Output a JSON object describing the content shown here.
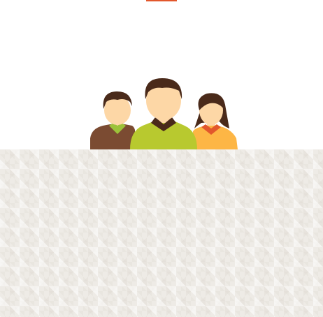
{
  "illustration": {
    "icon": "people-group-icon",
    "figures": [
      "person-left-icon",
      "person-center-icon",
      "person-right-icon"
    ]
  },
  "colors": {
    "accent": "#e2572c",
    "skin": "#fdd7a6",
    "hair": "#4a2a1a",
    "shirt_left": "#7b4b32",
    "collar_left": "#9cc23a",
    "shirt_center": "#b8c92f",
    "collar_center": "#4a2a1a",
    "shirt_right": "#fdb645",
    "collar_right": "#e2572c",
    "panel": "#eeebe6"
  }
}
